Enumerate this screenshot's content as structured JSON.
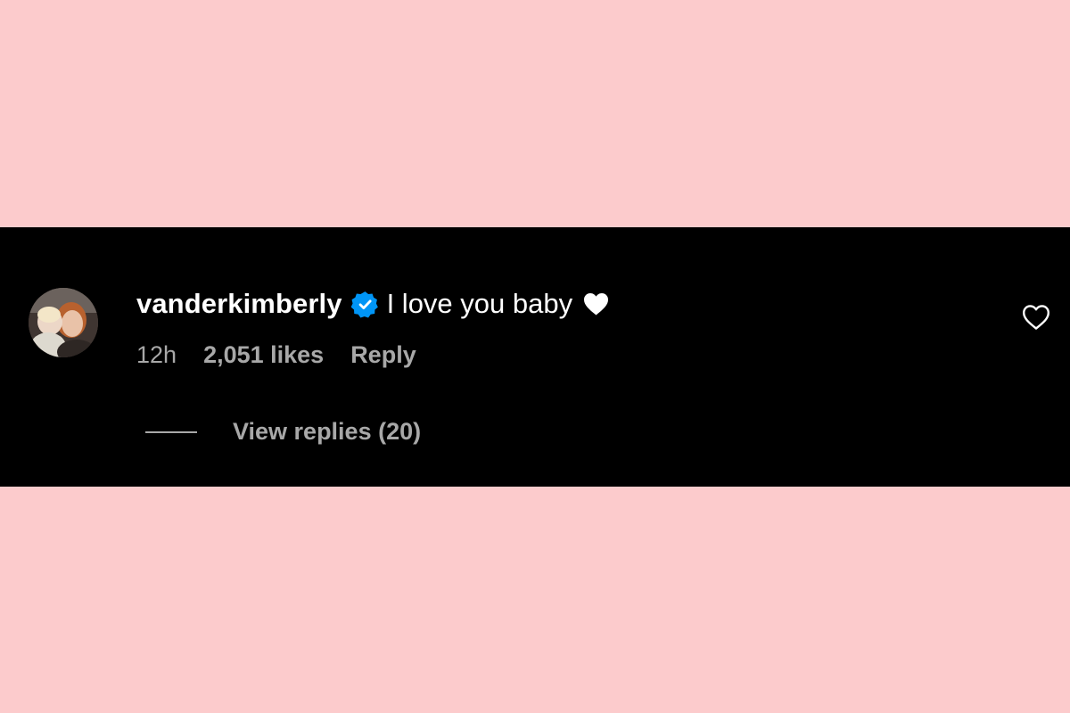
{
  "page": {
    "background_color": "#fccbcc",
    "panel_color": "#000000",
    "verified_color": "#0095f6",
    "muted_text_color": "#a8a8a8"
  },
  "comment": {
    "username": "vanderkimberly",
    "verified": true,
    "text": "I love you baby",
    "inline_emoji": "white-heart",
    "timestamp": "12h",
    "likes_label": "2,051 likes",
    "reply_label": "Reply",
    "view_replies_label": "View replies (20)",
    "like_icon": "heart-outline-icon",
    "avatar_icon": "avatar"
  }
}
